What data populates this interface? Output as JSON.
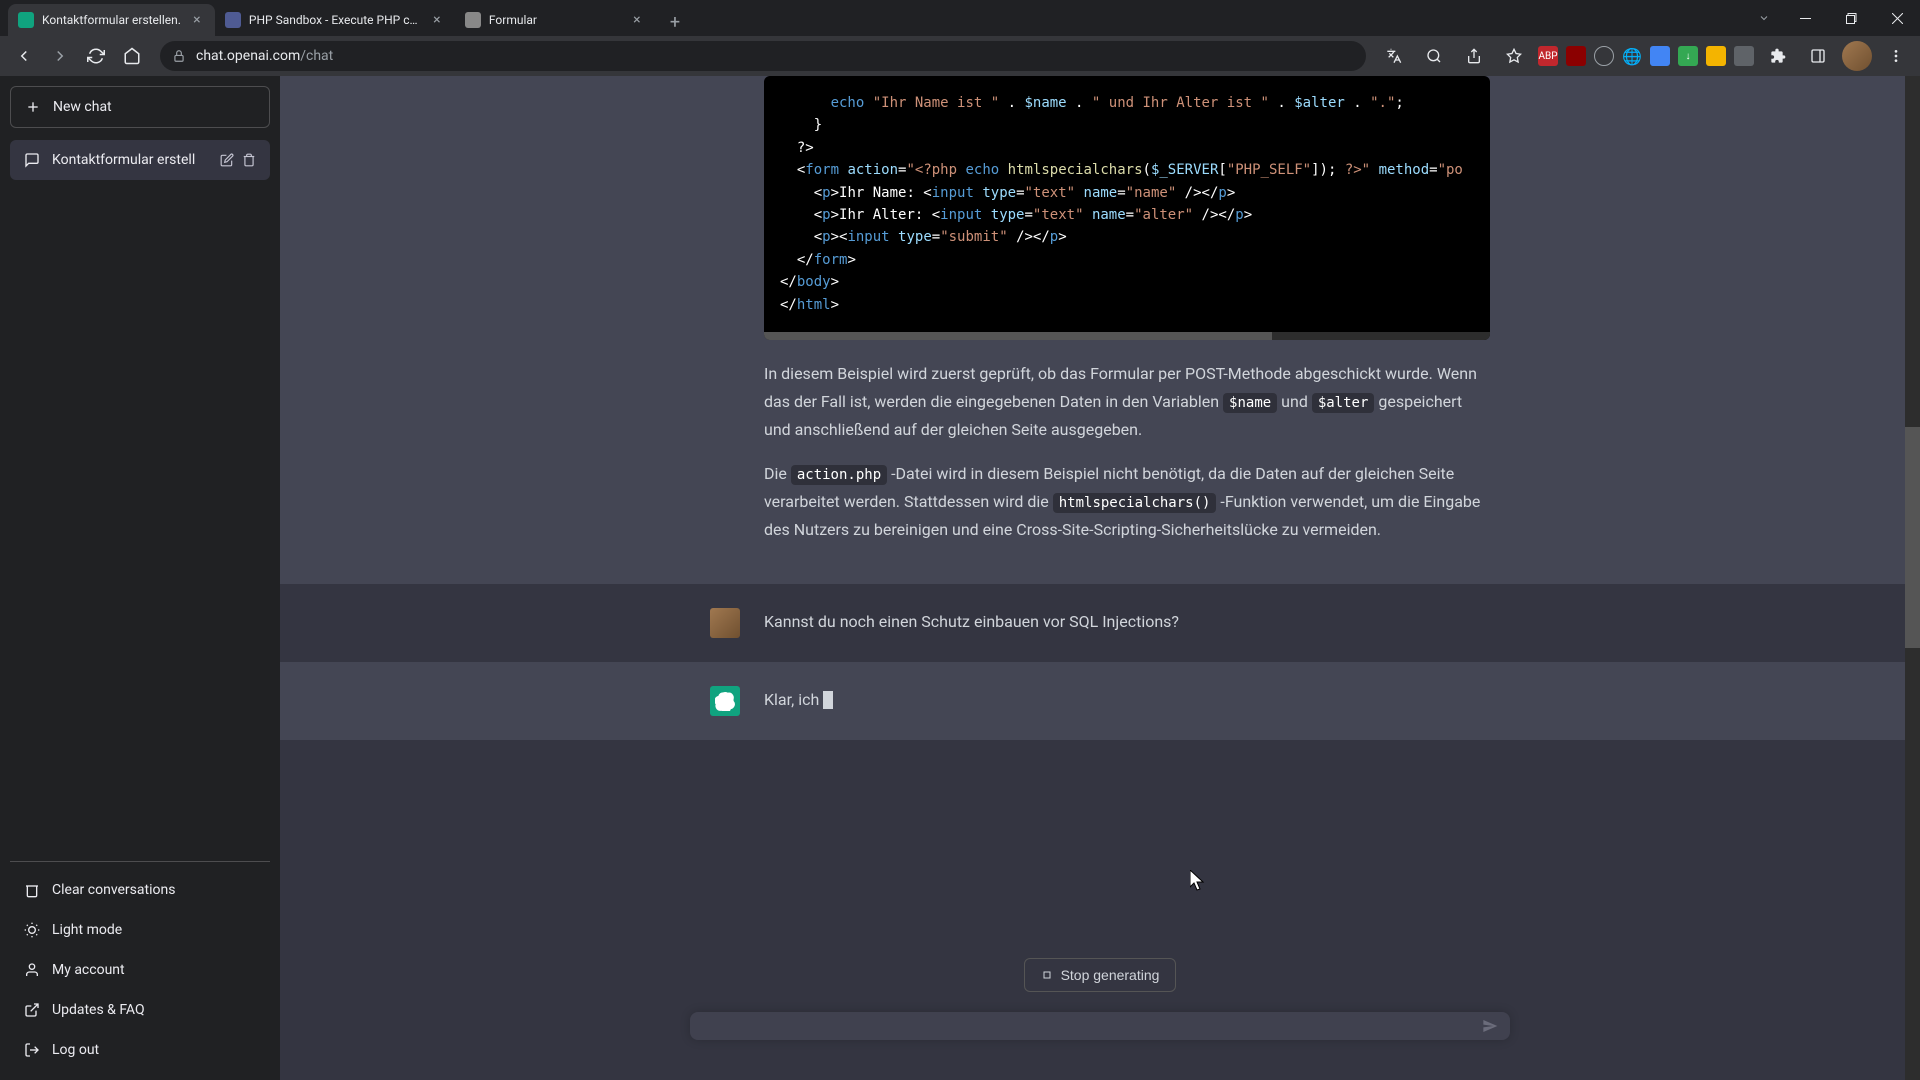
{
  "browser": {
    "tabs": [
      {
        "title": "Kontaktformular erstellen.",
        "active": true
      },
      {
        "title": "PHP Sandbox - Execute PHP cod",
        "active": false
      },
      {
        "title": "Formular",
        "active": false
      }
    ],
    "url_domain": "chat.openai.com",
    "url_path": "/chat"
  },
  "sidebar": {
    "new_chat_label": "New chat",
    "chats": [
      {
        "title": "Kontaktformular erstell"
      }
    ],
    "footer": {
      "clear": "Clear conversations",
      "light_mode": "Light mode",
      "account": "My account",
      "updates": "Updates & FAQ",
      "logout": "Log out"
    }
  },
  "messages": {
    "assistant_partial_code": {
      "lines_html": "      <span class='tok-keyword'>echo</span> <span class='tok-string'>\"Ihr Name ist \"</span> . <span class='tok-var'>$name</span> . <span class='tok-string'>\" und Ihr Alter ist \"</span> . <span class='tok-var'>$alter</span> . <span class='tok-string'>\".\"</span>;\n    }\n  ?>\n  &lt;<span class='tok-tag'>form</span> <span class='tok-attr'>action</span>=<span class='tok-string'>\"&lt;?php</span> <span class='tok-keyword'>echo</span> <span class='tok-func'>htmlspecialchars</span>(<span class='tok-var'>$_SERVER</span>[<span class='tok-string'>\"PHP_SELF\"</span>]); <span class='tok-string'>?&gt;\"</span> <span class='tok-attr'>method</span>=<span class='tok-string'>\"po</span>\n    &lt;<span class='tok-tag'>p</span>&gt;Ihr Name: &lt;<span class='tok-tag'>input</span> <span class='tok-attr'>type</span>=<span class='tok-string'>\"text\"</span> <span class='tok-attr'>name</span>=<span class='tok-string'>\"name\"</span> /&gt;&lt;/<span class='tok-tag'>p</span>&gt;\n    &lt;<span class='tok-tag'>p</span>&gt;Ihr Alter: &lt;<span class='tok-tag'>input</span> <span class='tok-attr'>type</span>=<span class='tok-string'>\"text\"</span> <span class='tok-attr'>name</span>=<span class='tok-string'>\"alter\"</span> /&gt;&lt;/<span class='tok-tag'>p</span>&gt;\n    &lt;<span class='tok-tag'>p</span>&gt;&lt;<span class='tok-tag'>input</span> <span class='tok-attr'>type</span>=<span class='tok-string'>\"submit\"</span> /&gt;&lt;/<span class='tok-tag'>p</span>&gt;\n  &lt;/<span class='tok-tag'>form</span>&gt;\n&lt;/<span class='tok-tag'>body</span>&gt;\n&lt;/<span class='tok-tag'>html</span>&gt;"
    },
    "assistant_explanation": {
      "p1_pre": "In diesem Beispiel wird zuerst geprüft, ob das Formular per POST-Methode abgeschickt wurde. Wenn das der Fall ist, werden die eingegebenen Daten in den Variablen ",
      "code1": "$name",
      "p1_mid": " und ",
      "code2": "$alter",
      "p1_post": " gespeichert und anschließend auf der gleichen Seite ausgegeben.",
      "p2_pre": "Die ",
      "code3": "action.php",
      "p2_mid": "-Datei wird in diesem Beispiel nicht benötigt, da die Daten auf der gleichen Seite verarbeitet werden. Stattdessen wird die ",
      "code4": "htmlspecialchars()",
      "p2_post": "-Funktion verwendet, um die Eingabe des Nutzers zu bereinigen und eine Cross-Site-Scripting-Sicherheitslücke zu vermeiden."
    },
    "user_question": "Kannst du noch einen Schutz einbauen vor SQL Injections?",
    "assistant_streaming": "Klar, ich"
  },
  "controls": {
    "stop_label": "Stop generating"
  }
}
